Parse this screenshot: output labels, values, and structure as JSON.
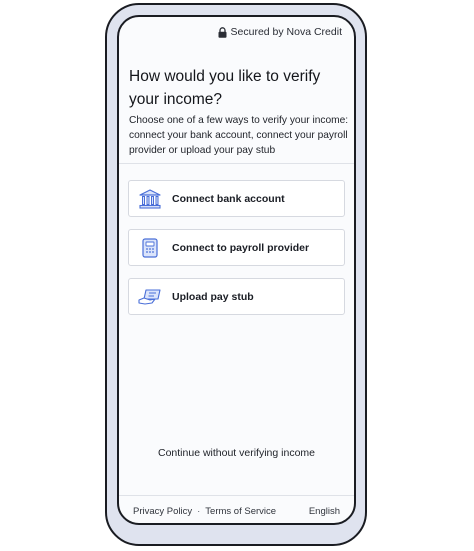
{
  "header": {
    "secured_text": "Secured by Nova Credit",
    "lock_icon": "lock-icon"
  },
  "main": {
    "title": "How would you like to verify your income?",
    "subtitle": "Choose one of a few ways to verify your income: connect your bank account, connect your payroll provider or upload your pay stub",
    "options": [
      {
        "label": "Connect bank account",
        "icon": "bank-icon"
      },
      {
        "label": "Connect to payroll provider",
        "icon": "payroll-icon"
      },
      {
        "label": "Upload pay stub",
        "icon": "pay-stub-icon"
      }
    ],
    "continue_label": "Continue without verifying income"
  },
  "footer": {
    "privacy_label": "Privacy Policy",
    "separator": "·",
    "terms_label": "Terms of Service",
    "language_label": "English"
  },
  "colors": {
    "icon_accent": "#4a6fd8",
    "icon_fill": "#dbe4fb",
    "phone_frame": "#dfe3ef"
  }
}
